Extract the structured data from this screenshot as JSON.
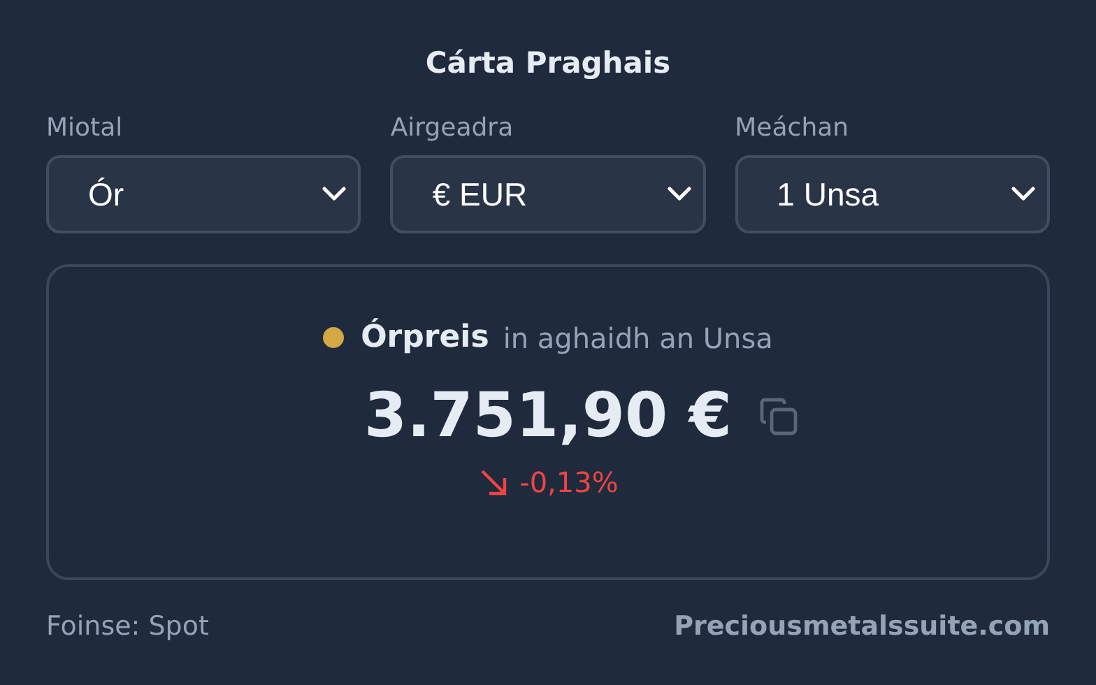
{
  "title": "Cárta Praghais",
  "selects": [
    {
      "label": "Miotal",
      "value": "Ór"
    },
    {
      "label": "Airgeadra",
      "value": "€ EUR"
    },
    {
      "label": "Meáchan",
      "value": "1 Unsa"
    }
  ],
  "price": {
    "name": "Órpreis",
    "color": "#d4a843",
    "unit": "in aghaidh an Unsa",
    "value": "3.751,90 €",
    "change": {
      "falling": true,
      "text": "-0,13%"
    }
  },
  "footer": {
    "source": "Foinse: Spot",
    "link": "Preciousmetalssuite.com"
  }
}
